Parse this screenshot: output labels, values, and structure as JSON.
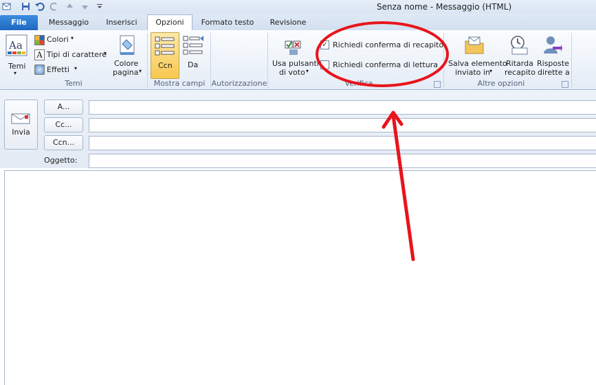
{
  "window": {
    "title": "Senza nome  -  Messaggio (HTML)"
  },
  "quick_access": {
    "icons": [
      "save-icon",
      "undo-icon",
      "redo-icon",
      "up-arrow-icon",
      "down-arrow-icon",
      "customize-icon"
    ]
  },
  "tabs": [
    {
      "label": "File"
    },
    {
      "label": "Messaggio"
    },
    {
      "label": "Inserisci"
    },
    {
      "label": "Opzioni"
    },
    {
      "label": "Formato testo"
    },
    {
      "label": "Revisione"
    }
  ],
  "ribbon": {
    "temi": {
      "temi_label": "Temi",
      "colori_label": "Colori",
      "tipi_label": "Tipi di carattere",
      "effetti_label": "Effetti",
      "colore_line1": "Colore",
      "colore_line2": "pagina",
      "group_label": "Temi"
    },
    "mostra_campi": {
      "ccn_label": "Ccn",
      "da_label": "Da",
      "group_label": "Mostra campi"
    },
    "autorizzazione": {
      "group_label": "Autorizzazione"
    },
    "verifica": {
      "voto_line1": "Usa pulsanti",
      "voto_line2": "di voto",
      "recapito_label": "Richiedi conferma di recapito",
      "recapito_checked": true,
      "lettura_label": "Richiedi conferma di lettura",
      "lettura_checked": false,
      "group_label": "Verifica"
    },
    "altre_opzioni": {
      "salva_line1": "Salva elemento",
      "salva_line2": "inviato in",
      "ritarda_line1": "Ritarda",
      "ritarda_line2": "recapito",
      "risposte_line1": "Risposte",
      "risposte_line2": "dirette a",
      "group_label": "Altre opzioni"
    }
  },
  "compose": {
    "send_label": "Invia",
    "to_label": "A...",
    "cc_label": "Cc...",
    "bcc_label": "Ccn...",
    "subject_label": "Oggetto:",
    "to_value": "",
    "cc_value": "",
    "bcc_value": "",
    "subject_value": "",
    "body": ""
  },
  "colors": {
    "file_tab": "#2a72cf",
    "ribbon_border": "#9fb6d3",
    "annotation_red": "#e8141c"
  }
}
